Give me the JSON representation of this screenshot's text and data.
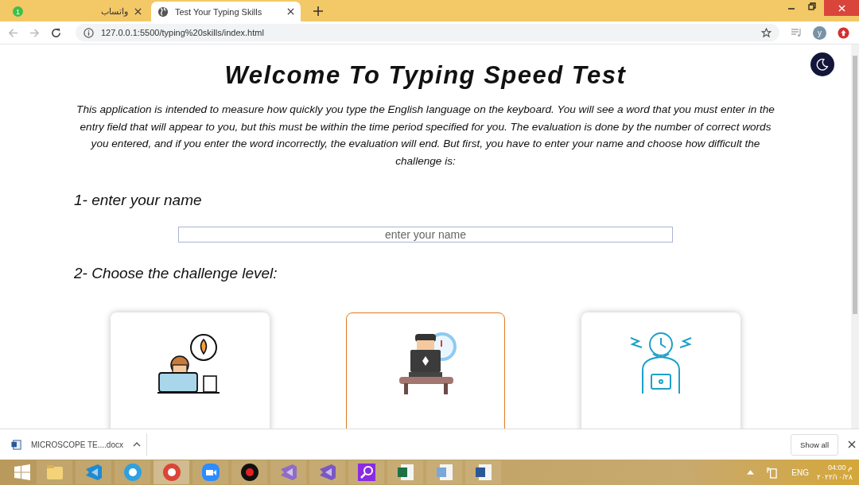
{
  "browser": {
    "tabs": [
      {
        "title": "واتساب",
        "kind": "chat",
        "selected": false,
        "badge": "1"
      },
      {
        "title": "Test Your Typing Skills",
        "kind": "globe",
        "selected": true
      }
    ],
    "url": "127.0.0.1:5500/typing%20skills/index.html",
    "profile": "y"
  },
  "page": {
    "title": "Welcome To Typing Speed Test",
    "intro": "This application is intended to measure how quickly you type the English language on the keyboard. You will see a word that you must enter in the entry field that will appear to you, but this must be within the time period specified for you. The evaluation is done by the number of correct words you entered, and if you enter the word incorrectly, the evaluation will end. But first, you have to enter your name and choose how difficult the challenge is:",
    "name_label": "1- enter your name",
    "name_field": {
      "placeholder": "enter your name"
    },
    "level_label": "2- Choose the challenge level:",
    "levels": [
      {
        "kind": "calm",
        "selected": false
      },
      {
        "kind": "clock",
        "selected": true
      },
      {
        "kind": "stressed",
        "selected": false
      }
    ]
  },
  "downloads": {
    "file": "MICROSCOPE TE....docx",
    "show_all": "Show all"
  },
  "taskbar": {
    "apps": [
      {
        "kind": "files",
        "active": false
      },
      {
        "kind": "code",
        "active": false
      },
      {
        "kind": "ie",
        "active": false
      },
      {
        "kind": "chrome",
        "active": true
      },
      {
        "kind": "zoom",
        "active": false
      },
      {
        "kind": "record",
        "active": false
      },
      {
        "kind": "vs-install",
        "active": false
      },
      {
        "kind": "vs",
        "active": false
      },
      {
        "kind": "search",
        "active": false
      },
      {
        "kind": "excel",
        "active": false
      },
      {
        "kind": "paint",
        "active": false
      },
      {
        "kind": "word",
        "active": false
      }
    ],
    "lang": "ENG",
    "time": "04:00 م",
    "date": "٢٠٢٢/١٠/٢٨"
  }
}
